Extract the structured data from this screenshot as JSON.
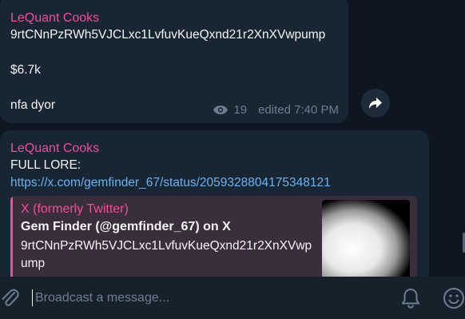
{
  "messages": [
    {
      "sender": "LeQuant Cooks",
      "lines": [
        "9rtCNnPzRWh5VJCLxc1LvfuvKueQxnd21r2XnXVwpump",
        "",
        "$6.7k",
        "",
        "nfa dyor"
      ],
      "views": "19",
      "edited": "edited 7:40 PM"
    },
    {
      "sender": "LeQuant Cooks",
      "text": "FULL LORE:",
      "link": "https://x.com/gemfinder_67/status/2059328804175348121",
      "preview": {
        "site": "X (formerly Twitter)",
        "title": "Gem Finder (@gemfinder_67) on X",
        "description": "9rtCNnPzRWh5VJCLxc1LvfuvKueQxnd21r2XnXVwpump"
      }
    }
  ],
  "composer": {
    "placeholder": "Broadcast a message..."
  },
  "colors": {
    "background": "#0e1621",
    "bubble": "#182533",
    "sender": "#ee4e9a",
    "link": "#6ab3f3",
    "meta": "#6d7f8f"
  },
  "icons": [
    "eye-icon",
    "forward-icon",
    "paperclip-icon",
    "bell-icon",
    "smile-icon"
  ]
}
